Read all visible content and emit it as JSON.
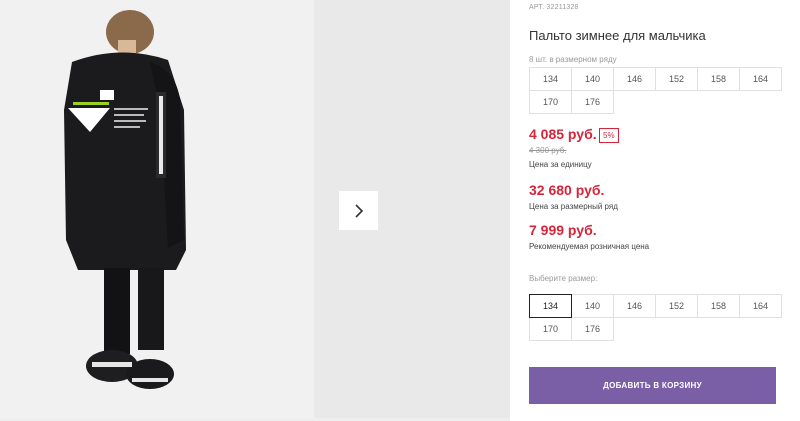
{
  "product": {
    "sku": "АРТ. 32211328",
    "title": "Пальто зимнее для мальчика",
    "row_note": "8 шт. в размерном ряду",
    "row_sizes": [
      "134",
      "140",
      "146",
      "152",
      "158",
      "164",
      "170",
      "176"
    ]
  },
  "prices": {
    "unit_price": "4 085 руб.",
    "discount_badge": "5%",
    "old_price": "4 300 руб.",
    "unit_caption": "Цена за единицу",
    "row_price": "32 680 руб.",
    "row_caption": "Цена за размерный ряд",
    "retail_price": "7 999 руб.",
    "retail_caption": "Рекомендуемая розничная цена"
  },
  "size_picker": {
    "label": "Выберите размер:",
    "sizes": [
      "134",
      "140",
      "146",
      "152",
      "158",
      "164",
      "170",
      "176"
    ],
    "selected": "134"
  },
  "actions": {
    "add_to_cart": "ДОБАВИТЬ В КОРЗИНУ"
  },
  "gallery": {
    "next_icon": "chevron-right-icon"
  },
  "colors": {
    "accent_price": "#d6253a",
    "cart_button": "#7a5fa6"
  }
}
